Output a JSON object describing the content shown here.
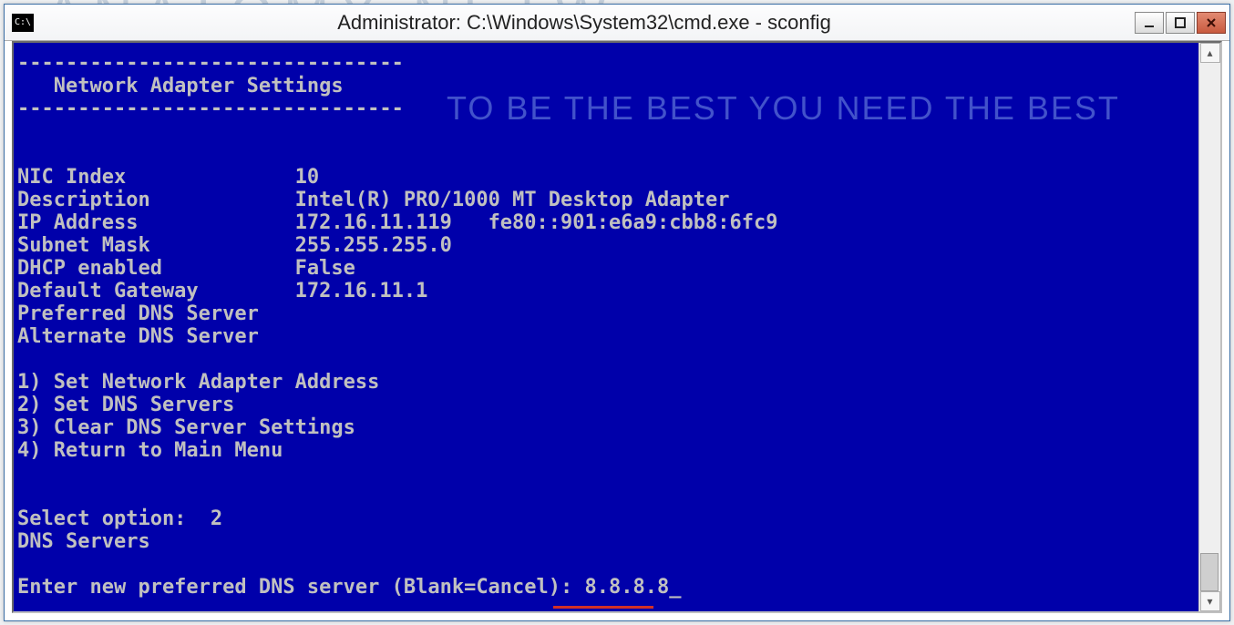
{
  "window": {
    "title": "Administrator: C:\\Windows\\System32\\cmd.exe - sconfig",
    "sysicon": "C:\\"
  },
  "watermark": {
    "top": "ANATOMY NETW",
    "mid": "TO BE THE BEST YOU NEED THE BEST"
  },
  "console": {
    "dash1": "--------------------------------",
    "header": "   Network Adapter Settings",
    "dash2": "--------------------------------",
    "blank": "",
    "nic_label": "NIC Index",
    "nic_val": "10",
    "desc_label": "Description",
    "desc_val": "Intel(R) PRO/1000 MT Desktop Adapter",
    "ip_label": "IP Address",
    "ip_val": "172.16.11.119   fe80::901:e6a9:cbb8:6fc9",
    "mask_label": "Subnet Mask",
    "mask_val": "255.255.255.0",
    "dhcp_label": "DHCP enabled",
    "dhcp_val": "False",
    "gw_label": "Default Gateway",
    "gw_val": "172.16.11.1",
    "pdns_label": "Preferred DNS Server",
    "pdns_val": "",
    "adns_label": "Alternate DNS Server",
    "adns_val": "",
    "opt1": "1) Set Network Adapter Address",
    "opt2": "2) Set DNS Servers",
    "opt3": "3) Clear DNS Server Settings",
    "opt4": "4) Return to Main Menu",
    "select_prompt": "Select option:  2",
    "dns_heading": "DNS Servers",
    "enter_prompt": "Enter new preferred DNS server (Blank=Cancel): ",
    "enter_value": "8.8.8.8_"
  }
}
